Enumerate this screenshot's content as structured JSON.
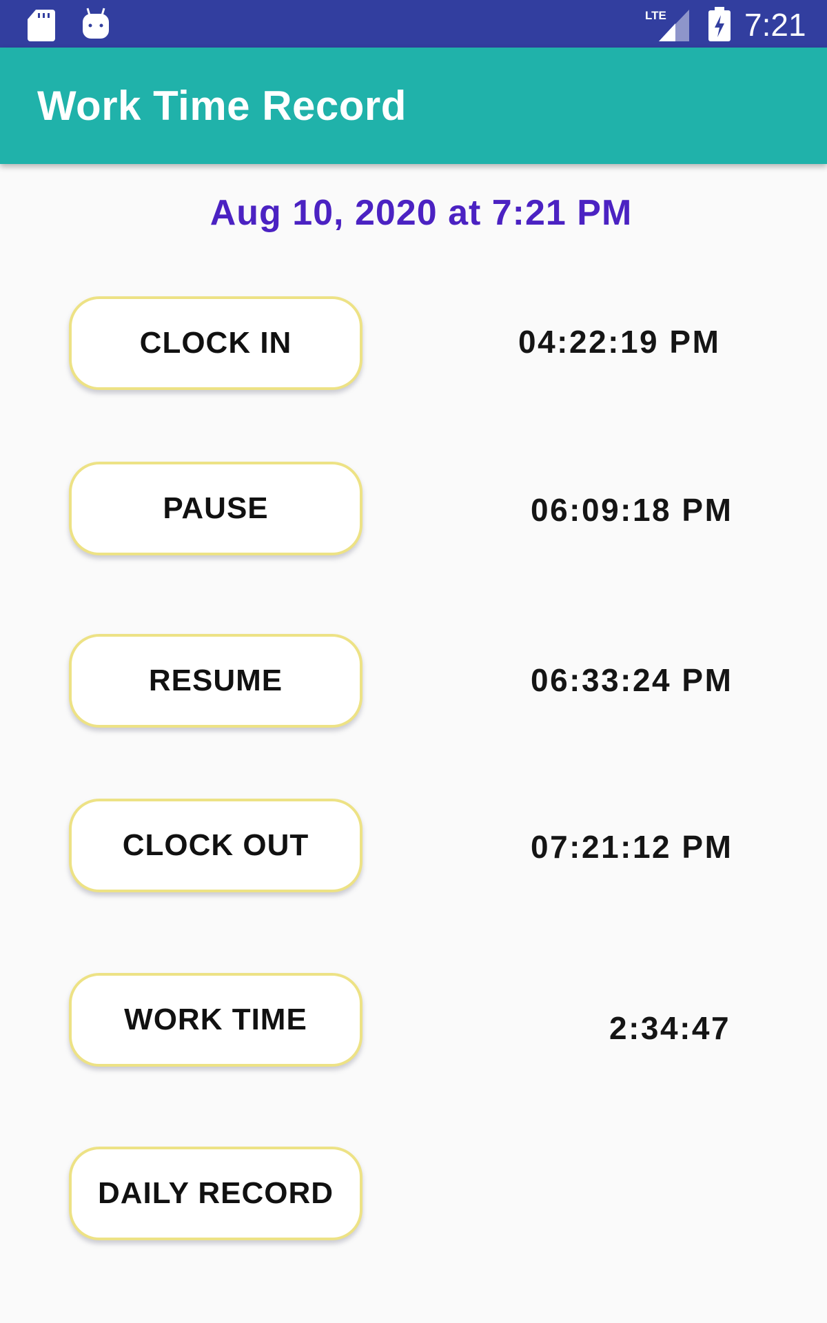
{
  "status_bar": {
    "time": "7:21",
    "icons": [
      "sd-card-icon",
      "android-debug-icon",
      "lte-signal-icon",
      "battery-charging-icon"
    ],
    "colors": {
      "background": "#323e9f"
    }
  },
  "app_bar": {
    "title": "Work Time Record",
    "colors": {
      "background": "#20b2aa",
      "text": "#ffffff"
    }
  },
  "main": {
    "current_datetime": "Aug 10, 2020 at 7:21 PM",
    "datetime_color": "#4b22c2",
    "button_border_color": "#ede285",
    "rows": [
      {
        "button_label": "CLOCK IN",
        "value": "04:22:19 PM"
      },
      {
        "button_label": "PAUSE",
        "value": "06:09:18 PM"
      },
      {
        "button_label": "RESUME",
        "value": "06:33:24 PM"
      },
      {
        "button_label": "CLOCK OUT",
        "value": "07:21:12 PM"
      },
      {
        "button_label": "WORK TIME",
        "value": "2:34:47"
      },
      {
        "button_label": "DAILY RECORD",
        "value": ""
      }
    ]
  }
}
